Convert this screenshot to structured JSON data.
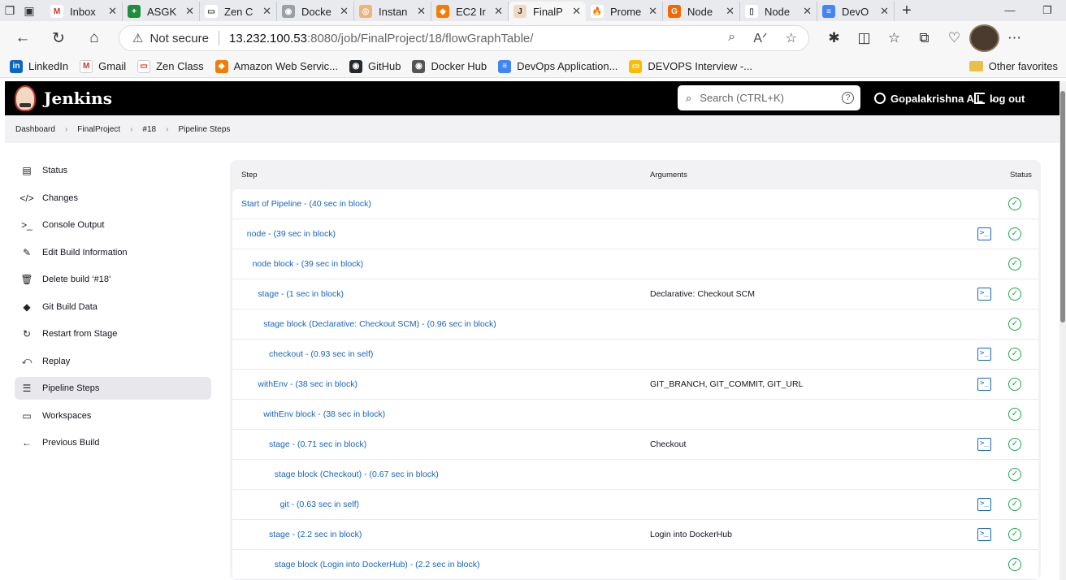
{
  "browser": {
    "tabs": [
      {
        "title": "Inbox",
        "fav_color": "#ffffff",
        "fav_text": "M",
        "fav_fg": "#d93025"
      },
      {
        "title": "ASGK",
        "fav_color": "#1e8e3e",
        "fav_text": "+",
        "fav_fg": "#ffffff"
      },
      {
        "title": "Zen C",
        "fav_color": "#ffffff",
        "fav_text": "▭",
        "fav_fg": "#444444"
      },
      {
        "title": "Docke",
        "fav_color": "#9aa0a6",
        "fav_text": "◉",
        "fav_fg": "#ffffff"
      },
      {
        "title": "Instan",
        "fav_color": "#f0b47a",
        "fav_text": "◎",
        "fav_fg": "#ffffff"
      },
      {
        "title": "EC2 Ir",
        "fav_color": "#f57c00",
        "fav_text": "◆",
        "fav_fg": "#ffffff"
      },
      {
        "title": "FinalP",
        "fav_color": "#f2d9c4",
        "fav_text": "J",
        "fav_fg": "#333333"
      },
      {
        "title": "Prome",
        "fav_color": "#ffffff",
        "fav_text": "🔥",
        "fav_fg": "#e6522c"
      },
      {
        "title": "Node",
        "fav_color": "#f46800",
        "fav_text": "G",
        "fav_fg": "#ffffff"
      },
      {
        "title": "Node",
        "fav_color": "#ffffff",
        "fav_text": "▯",
        "fav_fg": "#444444"
      },
      {
        "title": "DevO",
        "fav_color": "#4285f4",
        "fav_text": "≡",
        "fav_fg": "#ffffff"
      }
    ],
    "address": {
      "not_secure": "Not secure",
      "host": "13.232.100.53",
      "path": ":8080/job/FinalProject/18/flowGraphTable/"
    },
    "bookmarks": [
      {
        "label": "LinkedIn",
        "color": "#0a66c2",
        "glyph": "in"
      },
      {
        "label": "Gmail",
        "color": "#ffffff",
        "glyph": "M"
      },
      {
        "label": "Zen Class",
        "color": "#ffffff",
        "glyph": "▭"
      },
      {
        "label": "Amazon Web Servic...",
        "color": "#f57c00",
        "glyph": "◆"
      },
      {
        "label": "GitHub",
        "color": "#24292e",
        "glyph": "◉"
      },
      {
        "label": "Docker Hub",
        "color": "#555555",
        "glyph": "◉"
      },
      {
        "label": "DevOps Application...",
        "color": "#4285f4",
        "glyph": "≡"
      },
      {
        "label": "DEVOPS Interview -...",
        "color": "#fbbc04",
        "glyph": "▭"
      }
    ],
    "other_favorites": "Other favorites"
  },
  "jenkins": {
    "title": "Jenkins",
    "search_placeholder": "Search (CTRL+K)",
    "help_glyph": "?",
    "user": "Gopalakrishna A L",
    "logout": "log out"
  },
  "breadcrumb": [
    "Dashboard",
    "FinalProject",
    "#18",
    "Pipeline Steps"
  ],
  "sidebar": [
    {
      "label": "Status",
      "icon": "document-icon",
      "glyph": "▤"
    },
    {
      "label": "Changes",
      "icon": "code-icon",
      "glyph": "</>"
    },
    {
      "label": "Console Output",
      "icon": "terminal-icon",
      "glyph": ">_"
    },
    {
      "label": "Edit Build Information",
      "icon": "edit-icon",
      "glyph": "✎"
    },
    {
      "label": "Delete build ‘#18’",
      "icon": "trash-icon",
      "glyph": "🗑"
    },
    {
      "label": "Git Build Data",
      "icon": "git-icon",
      "glyph": "◆"
    },
    {
      "label": "Restart from Stage",
      "icon": "restart-icon",
      "glyph": "↻"
    },
    {
      "label": "Replay",
      "icon": "replay-icon",
      "glyph": "⤺"
    },
    {
      "label": "Pipeline Steps",
      "icon": "list-icon",
      "glyph": "☰"
    },
    {
      "label": "Workspaces",
      "icon": "folder-icon",
      "glyph": "▭"
    },
    {
      "label": "Previous Build",
      "icon": "arrow-left-icon",
      "glyph": "←"
    }
  ],
  "table": {
    "headers": {
      "step": "Step",
      "arguments": "Arguments",
      "status": "Status"
    },
    "rows": [
      {
        "step": "Start of Pipeline - (40 sec in block)",
        "args": "",
        "indent": 0,
        "console": false
      },
      {
        "step": "node - (39 sec in block)",
        "args": "",
        "indent": 1,
        "console": true
      },
      {
        "step": "node block - (39 sec in block)",
        "args": "",
        "indent": 2,
        "console": false
      },
      {
        "step": "stage - (1 sec in block)",
        "args": "Declarative: Checkout SCM",
        "indent": 3,
        "console": true
      },
      {
        "step": "stage block (Declarative: Checkout SCM) - (0.96 sec in block)",
        "args": "",
        "indent": 4,
        "console": false
      },
      {
        "step": "checkout - (0.93 sec in self)",
        "args": "",
        "indent": 5,
        "console": true
      },
      {
        "step": "withEnv - (38 sec in block)",
        "args": "GIT_BRANCH, GIT_COMMIT, GIT_URL",
        "indent": 3,
        "console": true
      },
      {
        "step": "withEnv block - (38 sec in block)",
        "args": "",
        "indent": 4,
        "console": false
      },
      {
        "step": "stage - (0.71 sec in block)",
        "args": "Checkout",
        "indent": 5,
        "console": true
      },
      {
        "step": "stage block (Checkout) - (0.67 sec in block)",
        "args": "",
        "indent": 6,
        "console": false
      },
      {
        "step": "git - (0.63 sec in self)",
        "args": "",
        "indent": 7,
        "console": true
      },
      {
        "step": "stage - (2.2 sec in block)",
        "args": "Login into DockerHub",
        "indent": 5,
        "console": true
      },
      {
        "step": "stage block (Login into DockerHub) - (2.2 sec in block)",
        "args": "",
        "indent": 6,
        "console": false
      }
    ]
  },
  "colors": {
    "link": "#1565c0",
    "success": "#1ea64b",
    "header_bg": "#000000"
  }
}
